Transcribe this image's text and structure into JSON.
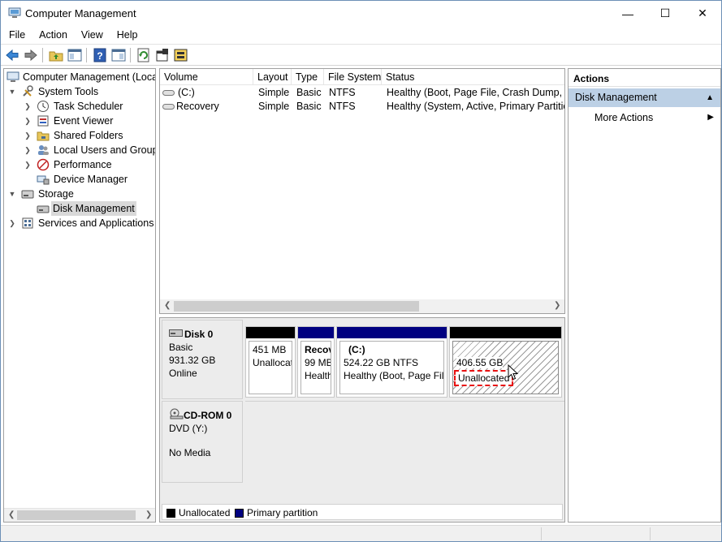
{
  "window": {
    "title": "Computer Management",
    "minimize_glyph": "—",
    "maximize_glyph": "☐",
    "close_glyph": "✕"
  },
  "menu": [
    "File",
    "Action",
    "View",
    "Help"
  ],
  "toolbar": {
    "icons": [
      "back-arrow-icon",
      "forward-arrow-icon",
      "up-folder-icon",
      "show-hide-tree-icon",
      "help-icon",
      "show-hide-action-pane-icon",
      "refresh-icon",
      "properties-icon",
      "disk-settings-icon"
    ]
  },
  "tree": {
    "root": "Computer Management (Local",
    "system_tools": "System Tools",
    "task_scheduler": "Task Scheduler",
    "event_viewer": "Event Viewer",
    "shared_folders": "Shared Folders",
    "local_users": "Local Users and Groups",
    "performance": "Performance",
    "device_manager": "Device Manager",
    "storage": "Storage",
    "disk_management": "Disk Management",
    "services": "Services and Applications"
  },
  "volume_list": {
    "columns": [
      "Volume",
      "Layout",
      "Type",
      "File System",
      "Status"
    ],
    "rows": [
      [
        "(C:)",
        "Simple",
        "Basic",
        "NTFS",
        "Healthy (Boot, Page File, Crash Dump, Pri"
      ],
      [
        "Recovery",
        "Simple",
        "Basic",
        "NTFS",
        "Healthy (System, Active, Primary Partition"
      ]
    ]
  },
  "disks": {
    "disk0": {
      "name": "Disk 0",
      "type": "Basic",
      "size": "931.32 GB",
      "state": "Online",
      "partitions": {
        "p1": {
          "size": "451 MB",
          "desc": "Unallocat"
        },
        "p2": {
          "name": "Recov",
          "size": "99 MB",
          "desc": "Health"
        },
        "p3": {
          "name": "(C:)",
          "size": "524.22 GB NTFS",
          "desc": "Healthy (Boot, Page File"
        },
        "p4": {
          "size": "406.55 GB",
          "desc": "Unallocated"
        }
      }
    },
    "cdrom0": {
      "name": "CD-ROM 0",
      "drive": "DVD (Y:)",
      "media": "No Media"
    }
  },
  "legend": {
    "unallocated": "Unallocated",
    "primary": "Primary partition"
  },
  "colors": {
    "unallocated_bar": "#000000",
    "primary_bar": "#000080",
    "selected_section": "#bcd0e5",
    "highlight_dash": "#e81010"
  },
  "actions": {
    "title": "Actions",
    "section": "Disk Management",
    "more": "More Actions"
  }
}
